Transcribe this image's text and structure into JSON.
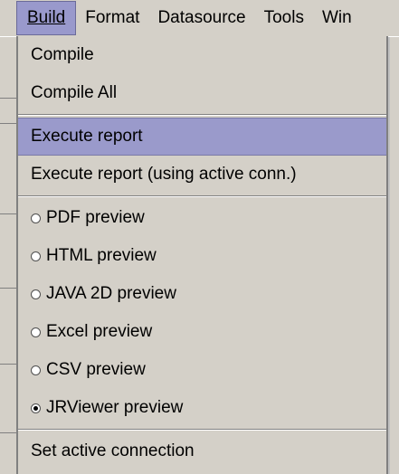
{
  "menubar": {
    "items": [
      {
        "label": "Build"
      },
      {
        "label": "Format"
      },
      {
        "label": "Datasource"
      },
      {
        "label": "Tools"
      },
      {
        "label": "Win"
      }
    ]
  },
  "dropdown": {
    "compile": "Compile",
    "compile_all": "Compile All",
    "execute_report": "Execute report",
    "execute_report_active": "Execute report (using active conn.)",
    "previews": [
      {
        "label": "PDF preview",
        "checked": false
      },
      {
        "label": "HTML preview",
        "checked": false
      },
      {
        "label": "JAVA 2D preview",
        "checked": false
      },
      {
        "label": "Excel preview",
        "checked": false
      },
      {
        "label": "CSV preview",
        "checked": false
      },
      {
        "label": "JRViewer preview",
        "checked": true
      }
    ],
    "set_active_connection": "Set active connection"
  },
  "colors": {
    "menu_bg": "#d4d0c8",
    "highlight": "#9a9acb"
  }
}
